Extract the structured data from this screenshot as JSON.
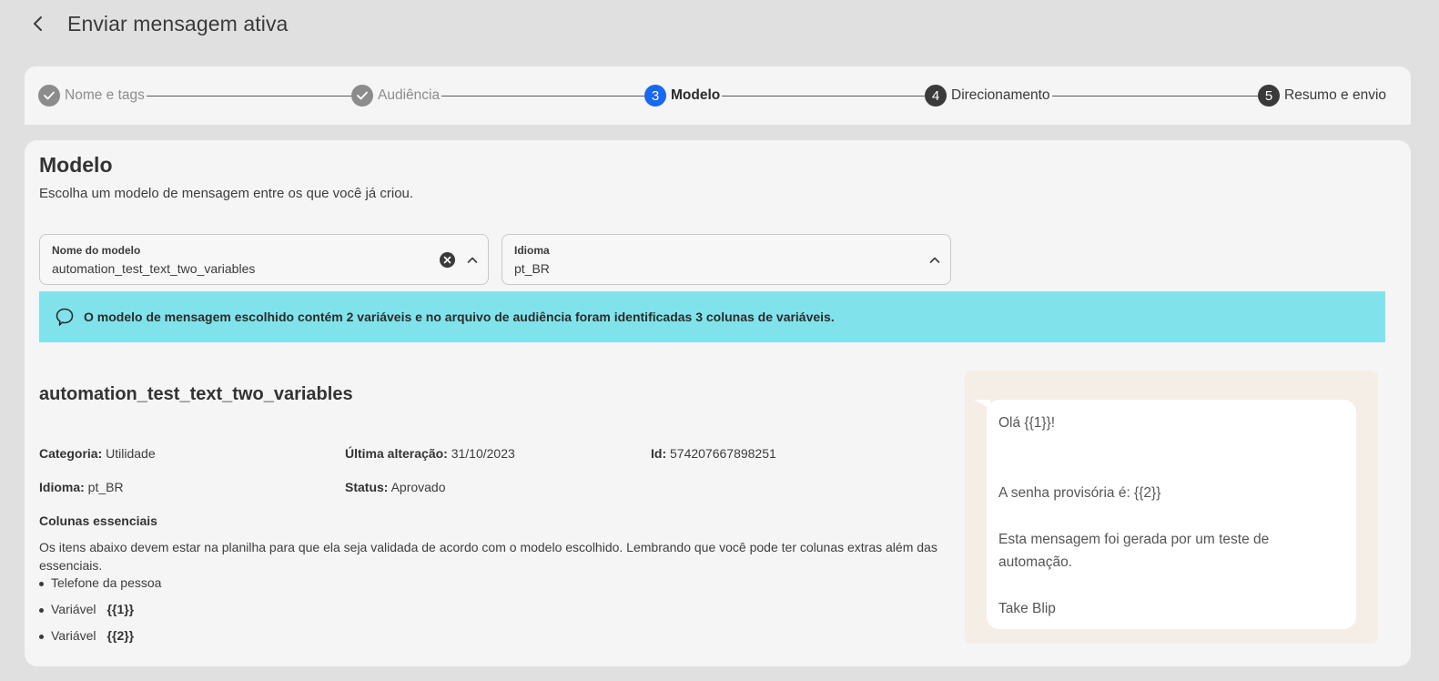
{
  "header": {
    "title": "Enviar mensagem ativa"
  },
  "stepper": {
    "steps": [
      {
        "number": "",
        "label": "Nome e tags",
        "state": "done"
      },
      {
        "number": "",
        "label": "Audiência",
        "state": "done"
      },
      {
        "number": "3",
        "label": "Modelo",
        "state": "active"
      },
      {
        "number": "4",
        "label": "Direcionamento",
        "state": "todo"
      },
      {
        "number": "5",
        "label": "Resumo e envio",
        "state": "todo"
      }
    ]
  },
  "section": {
    "title": "Modelo",
    "subtitle": "Escolha um modelo de mensagem entre os que você já criou."
  },
  "template_select": {
    "label": "Nome do modelo",
    "value": "automation_test_text_two_variables"
  },
  "language_select": {
    "label": "Idioma",
    "value": "pt_BR"
  },
  "alert": {
    "text": "O modelo de mensagem escolhido contém 2 variáveis e no arquivo de audiência foram identificadas 3 colunas de variáveis."
  },
  "template": {
    "name": "automation_test_text_two_variables",
    "category_label": "Categoria:",
    "category": "Utilidade",
    "last_change_label": "Última alteração:",
    "last_change": "31/10/2023",
    "id_label": "Id:",
    "id": "574207667898251",
    "language_label": "Idioma:",
    "language": "pt_BR",
    "status_label": "Status:",
    "status": "Aprovado"
  },
  "essentials": {
    "title": "Colunas essenciais",
    "description": "Os itens abaixo devem estar na planilha para que ela seja validada de acordo com o modelo escolhido. Lembrando que você pode ter colunas extras além das essenciais.",
    "items": [
      {
        "text": "Telefone da pessoa",
        "var": ""
      },
      {
        "text": "Variável",
        "var": "{{1}}"
      },
      {
        "text": "Variável",
        "var": "{{2}}"
      }
    ]
  },
  "preview": {
    "message": "Olá {{1}}!\n\n\nA senha provisória é: {{2}}\n\nEsta mensagem foi gerada por um teste de automação.\n\nTake Blip"
  },
  "colors": {
    "active": "#1968f0",
    "done": "#8c8c8c",
    "alert_bg": "#80e3eb",
    "preview_bg": "#f4eee6"
  }
}
